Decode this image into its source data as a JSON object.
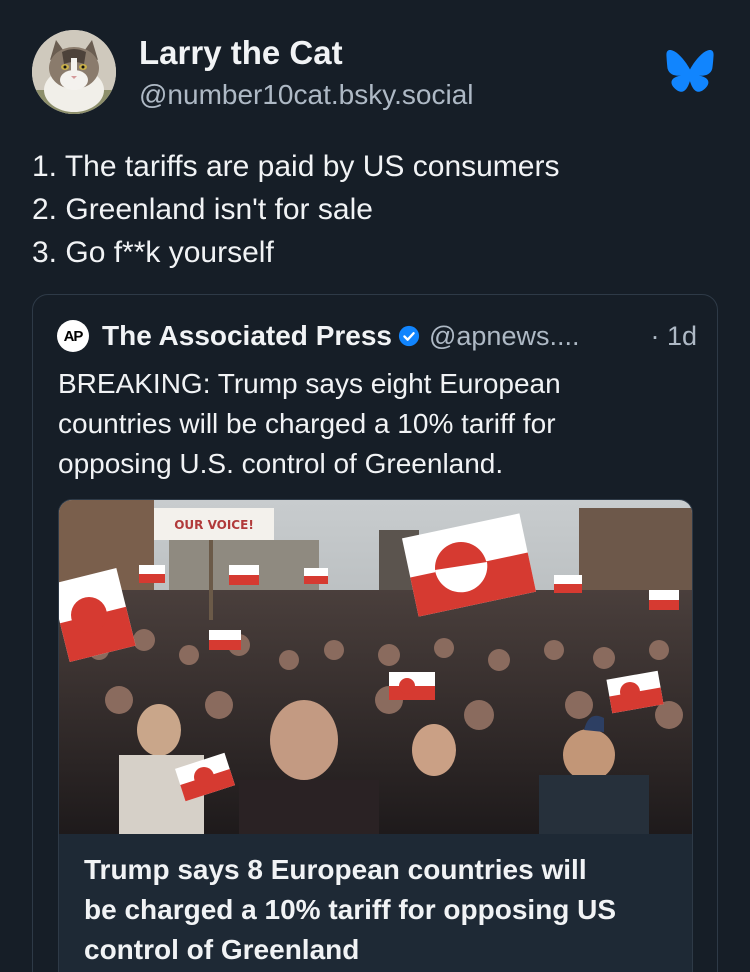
{
  "post": {
    "author_name": "Larry the Cat",
    "author_handle": "@number10cat.bsky.social",
    "text_lines": [
      "1. The tariffs are paid by US consumers",
      "2. Greenland isn't for sale",
      "3. Go f**k yourself"
    ]
  },
  "quote": {
    "logo_text": "AP",
    "author_name": "The Associated Press",
    "author_handle": "@apnews....",
    "timestamp": "· 1d",
    "text_lines": [
      "BREAKING: Trump says eight European",
      "countries will be charged a 10% tariff for",
      "opposing U.S. control of Greenland."
    ],
    "embed": {
      "sign_text": "OUR VOICE!",
      "title_lines": [
        "Trump says 8 European countries will",
        "be charged a 10% tariff for opposing US",
        "control of Greenland"
      ]
    }
  },
  "icons": {
    "app_logo": "bluesky-butterfly-icon",
    "verified": "verified-check-icon"
  },
  "colors": {
    "background": "#161e27",
    "text_primary": "#f1f3f5",
    "text_secondary": "#aeb9c5",
    "bluesky_blue": "#1185fe",
    "verified_blue": "#1185fe"
  }
}
